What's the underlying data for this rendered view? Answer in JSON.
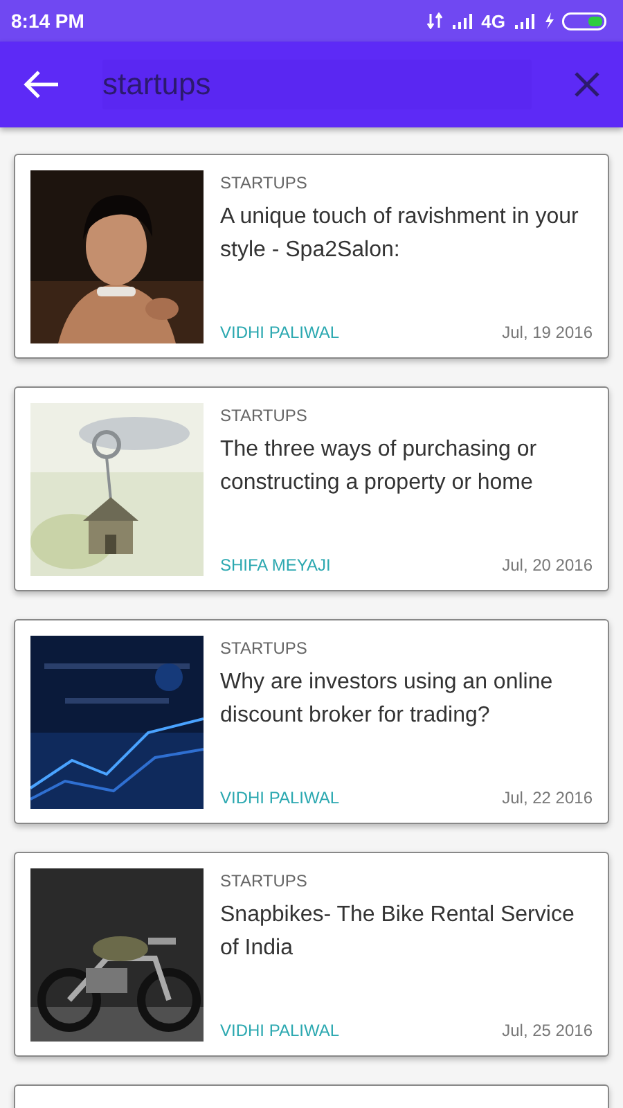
{
  "status_bar": {
    "time": "8:14 PM",
    "network": "4G"
  },
  "toolbar": {
    "search": {
      "value": "startups"
    }
  },
  "articles": [
    {
      "category": "STARTUPS",
      "title": "A unique touch of ravishment in your style - Spa2Salon:",
      "author": "VIDHI PALIWAL",
      "date": "Jul, 19 2016"
    },
    {
      "category": "STARTUPS",
      "title": "The three ways of purchasing or constructing a property or home",
      "author": "SHIFA MEYAJI",
      "date": "Jul, 20 2016"
    },
    {
      "category": "STARTUPS",
      "title": "Why are investors using an online discount broker for trading?",
      "author": "VIDHI PALIWAL",
      "date": "Jul, 22 2016",
      "thumbnail": {
        "kind": "chart"
      }
    },
    {
      "category": "STARTUPS",
      "title": "Snapbikes- The Bike Rental Service of India",
      "author": "VIDHI PALIWAL",
      "date": "Jul, 25 2016",
      "thumbnail": {
        "kind": "vehicle"
      }
    }
  ]
}
